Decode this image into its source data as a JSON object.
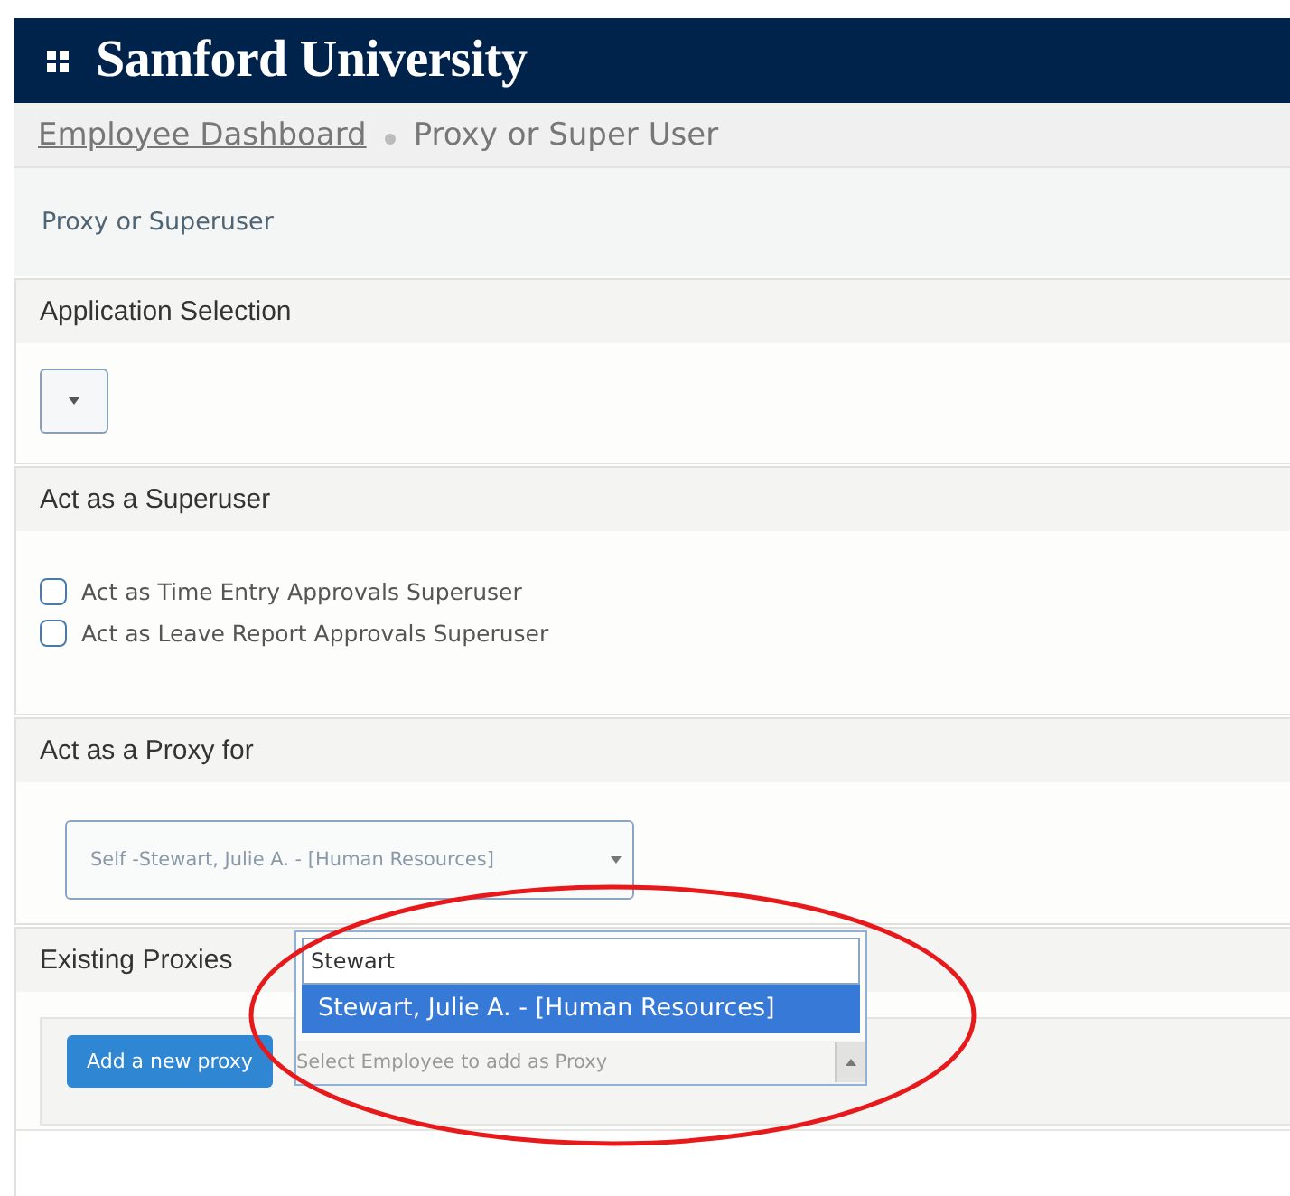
{
  "header": {
    "title": "Samford University"
  },
  "breadcrumb": [
    {
      "label": "Employee Dashboard",
      "kind": "link"
    },
    {
      "label": "Proxy or Super User",
      "kind": "current"
    }
  ],
  "page_title": "Proxy or Superuser",
  "sections": [
    {
      "kind": "select",
      "title": "Application Selection"
    },
    {
      "kind": "checkboxes",
      "title": "Act as a Superuser",
      "options": [
        {
          "label": "Act as Time Entry Approvals Superuser",
          "checked": false
        },
        {
          "label": "Act as Leave Report Approvals Superuser",
          "checked": false
        }
      ]
    },
    {
      "kind": "proxy",
      "title": "Act as a Proxy for",
      "value": "Self -Stewart, Julie A. - [Human Resources]"
    },
    {
      "kind": "existing",
      "title": "Existing Proxies",
      "button": "Add a new proxy",
      "dropdown": {
        "search": "Stewart",
        "options": [
          {
            "label": "Stewart, Julie A. - [Human Resources]",
            "selected": true
          }
        ],
        "placeholder": "Select Employee to add as Proxy",
        "expanded": true
      }
    }
  ]
}
